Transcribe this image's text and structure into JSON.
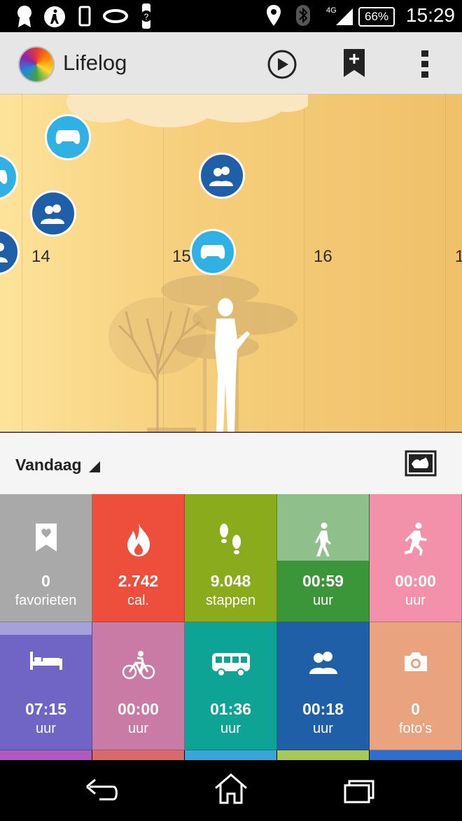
{
  "status_bar": {
    "time": "15:29",
    "battery": "66%",
    "network": "4G"
  },
  "app_bar": {
    "title": "Lifelog",
    "play_icon": "play-icon",
    "bookmark_icon": "bookmark-add-icon",
    "menu_icon": "overflow-menu-icon"
  },
  "timeline": {
    "hours": [
      "14",
      "15",
      "16",
      "1"
    ]
  },
  "day_bar": {
    "label": "Vandaag",
    "map_icon": "map-icon"
  },
  "tiles": [
    {
      "value": "0",
      "unit": "favorieten",
      "icon": "bookmark-heart-icon",
      "color": "#a9a9a9"
    },
    {
      "value": "2.742",
      "unit": "cal.",
      "icon": "flame-icon",
      "color": "#ed4f3c"
    },
    {
      "value": "9.048",
      "unit": "stappen",
      "icon": "footsteps-icon",
      "color": "#8aab1c"
    },
    {
      "value": "00:59",
      "unit": "uur",
      "icon": "walking-icon",
      "color": "#3a9639",
      "top_color": "#8fc08c",
      "fill": 0.48
    },
    {
      "value": "00:00",
      "unit": "uur",
      "icon": "running-icon",
      "color": "#f391aa"
    },
    {
      "value": "07:15",
      "unit": "uur",
      "icon": "bed-icon",
      "color": "#7064c4",
      "top_color": "#a59fdc",
      "fill": 0.9
    },
    {
      "value": "00:00",
      "unit": "uur",
      "icon": "bicycle-icon",
      "color": "#c97aa5"
    },
    {
      "value": "01:36",
      "unit": "uur",
      "icon": "bus-icon",
      "color": "#0ea495"
    },
    {
      "value": "00:18",
      "unit": "uur",
      "icon": "people-icon",
      "color": "#1f5fa8"
    },
    {
      "value": "0",
      "unit": "foto's",
      "icon": "camera-icon",
      "color": "#e9a37e"
    }
  ]
}
